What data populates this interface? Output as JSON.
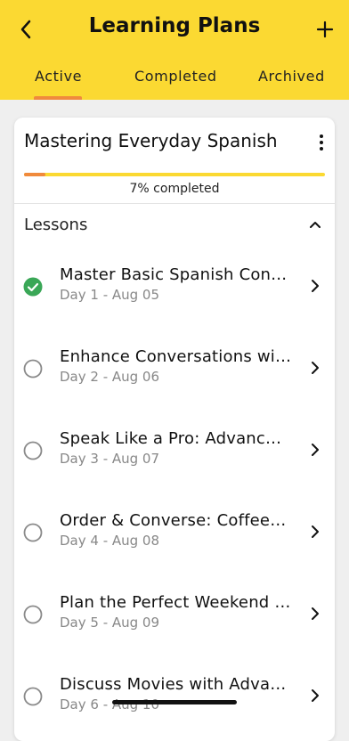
{
  "header": {
    "title": "Learning Plans",
    "back_icon": "chevron-left-icon",
    "add_icon": "plus-icon"
  },
  "tabs": [
    {
      "label": "Active",
      "selected": true
    },
    {
      "label": "Completed",
      "selected": false
    },
    {
      "label": "Archived",
      "selected": false
    }
  ],
  "plan": {
    "title": "Mastering Everyday Spanish",
    "progress_fraction": 0.07,
    "progress_text": "7% completed"
  },
  "lessons_section": {
    "heading": "Lessons",
    "expanded": true
  },
  "lessons": [
    {
      "title": "Master Basic Spanish Conversations",
      "subtitle": "Day 1 - Aug 05",
      "completed": true
    },
    {
      "title": "Enhance Conversations with Questions",
      "subtitle": "Day 2 - Aug 06",
      "completed": false
    },
    {
      "title": "Speak Like a Pro: Advanced Phrases",
      "subtitle": "Day 3 - Aug 07",
      "completed": false
    },
    {
      "title": "Order & Converse: Coffee Shop Chat",
      "subtitle": "Day 4 - Aug 08",
      "completed": false
    },
    {
      "title": "Plan the Perfect Weekend Getaway",
      "subtitle": "Day 5 - Aug 09",
      "completed": false
    },
    {
      "title": "Discuss Movies with Advanced Vocabulary",
      "subtitle": "Day 6 - Aug 10",
      "completed": false
    }
  ],
  "colors": {
    "accent_yellow": "#fbd932",
    "accent_orange": "#f08a3c",
    "check_green": "#3aa757",
    "background": "#efefef"
  }
}
